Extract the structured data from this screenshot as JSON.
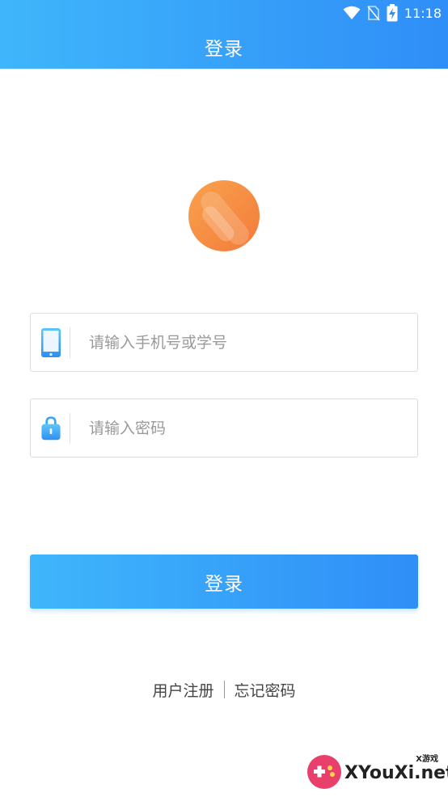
{
  "status_bar": {
    "time": "11:18"
  },
  "header": {
    "title": "登录"
  },
  "form": {
    "account_placeholder": "请输入手机号或学号",
    "password_placeholder": "请输入密码"
  },
  "login_button": {
    "label": "登录"
  },
  "links": {
    "register": "用户注册",
    "forgot": "忘记密码"
  },
  "watermark": {
    "text": "XYouXi.net",
    "small": "X游戏"
  },
  "colors": {
    "primary_start": "#3fb6fb",
    "primary_end": "#2f8ef7",
    "logo": "#f48a3f"
  },
  "icons": [
    "wifi-icon",
    "no-sim-icon",
    "battery-charging-icon",
    "phone-icon",
    "lock-icon"
  ]
}
